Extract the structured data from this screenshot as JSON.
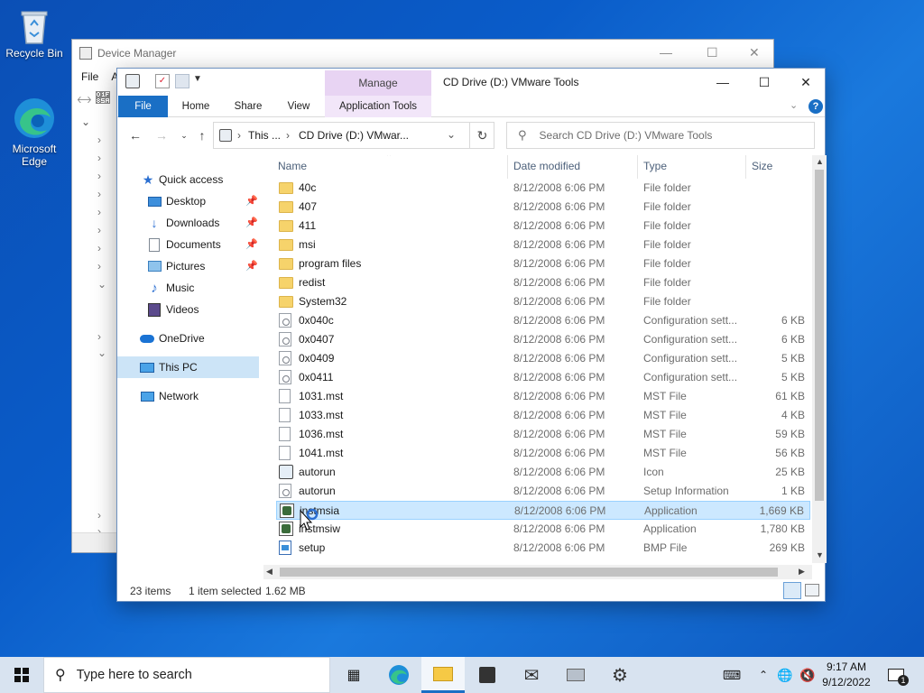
{
  "desktop": {
    "icons": [
      {
        "label": "Recycle Bin",
        "icon": "recycle-bin-icon"
      },
      {
        "label": "Microsoft Edge",
        "icon": "edge-icon"
      }
    ]
  },
  "device_manager": {
    "title": "Device Manager",
    "menu": [
      "File",
      "A"
    ]
  },
  "explorer": {
    "title": "CD Drive (D:) VMware Tools",
    "context_tab": "Manage",
    "ribbon_tabs": [
      "File",
      "Home",
      "Share",
      "View",
      "Application Tools"
    ],
    "address": {
      "crumbs": [
        "This ...",
        "CD Drive (D:) VMwar..."
      ]
    },
    "search_placeholder": "Search CD Drive (D:) VMware Tools",
    "nav": {
      "quick_access": "Quick access",
      "items": [
        {
          "label": "Desktop",
          "icon": "desktop-folder-icon",
          "pinned": true
        },
        {
          "label": "Downloads",
          "icon": "downloads-icon",
          "pinned": true
        },
        {
          "label": "Documents",
          "icon": "documents-icon",
          "pinned": true
        },
        {
          "label": "Pictures",
          "icon": "pictures-icon",
          "pinned": true
        },
        {
          "label": "Music",
          "icon": "music-icon",
          "pinned": false
        },
        {
          "label": "Videos",
          "icon": "videos-icon",
          "pinned": false
        }
      ],
      "onedrive": "OneDrive",
      "this_pc": "This PC",
      "network": "Network"
    },
    "columns": [
      "Name",
      "Date modified",
      "Type",
      "Size"
    ],
    "files": [
      {
        "name": "40c",
        "date": "8/12/2008 6:06 PM",
        "type": "File folder",
        "size": "",
        "kind": "folder"
      },
      {
        "name": "407",
        "date": "8/12/2008 6:06 PM",
        "type": "File folder",
        "size": "",
        "kind": "folder"
      },
      {
        "name": "411",
        "date": "8/12/2008 6:06 PM",
        "type": "File folder",
        "size": "",
        "kind": "folder"
      },
      {
        "name": "msi",
        "date": "8/12/2008 6:06 PM",
        "type": "File folder",
        "size": "",
        "kind": "folder"
      },
      {
        "name": "program files",
        "date": "8/12/2008 6:06 PM",
        "type": "File folder",
        "size": "",
        "kind": "folder"
      },
      {
        "name": "redist",
        "date": "8/12/2008 6:06 PM",
        "type": "File folder",
        "size": "",
        "kind": "folder"
      },
      {
        "name": "System32",
        "date": "8/12/2008 6:06 PM",
        "type": "File folder",
        "size": "",
        "kind": "folder"
      },
      {
        "name": "0x040c",
        "date": "8/12/2008 6:06 PM",
        "type": "Configuration sett...",
        "size": "6 KB",
        "kind": "config"
      },
      {
        "name": "0x0407",
        "date": "8/12/2008 6:06 PM",
        "type": "Configuration sett...",
        "size": "6 KB",
        "kind": "config"
      },
      {
        "name": "0x0409",
        "date": "8/12/2008 6:06 PM",
        "type": "Configuration sett...",
        "size": "5 KB",
        "kind": "config"
      },
      {
        "name": "0x0411",
        "date": "8/12/2008 6:06 PM",
        "type": "Configuration sett...",
        "size": "5 KB",
        "kind": "config"
      },
      {
        "name": "1031.mst",
        "date": "8/12/2008 6:06 PM",
        "type": "MST File",
        "size": "61 KB",
        "kind": "mst"
      },
      {
        "name": "1033.mst",
        "date": "8/12/2008 6:06 PM",
        "type": "MST File",
        "size": "4 KB",
        "kind": "mst"
      },
      {
        "name": "1036.mst",
        "date": "8/12/2008 6:06 PM",
        "type": "MST File",
        "size": "59 KB",
        "kind": "mst"
      },
      {
        "name": "1041.mst",
        "date": "8/12/2008 6:06 PM",
        "type": "MST File",
        "size": "56 KB",
        "kind": "mst"
      },
      {
        "name": "autorun",
        "date": "8/12/2008 6:06 PM",
        "type": "Icon",
        "size": "25 KB",
        "kind": "icon"
      },
      {
        "name": "autorun",
        "date": "8/12/2008 6:06 PM",
        "type": "Setup Information",
        "size": "1 KB",
        "kind": "config"
      },
      {
        "name": "instmsia",
        "date": "8/12/2008 6:06 PM",
        "type": "Application",
        "size": "1,669 KB",
        "kind": "app",
        "selected": true
      },
      {
        "name": "instmsiw",
        "date": "8/12/2008 6:06 PM",
        "type": "Application",
        "size": "1,780 KB",
        "kind": "app"
      },
      {
        "name": "setup",
        "date": "8/12/2008 6:06 PM",
        "type": "BMP File",
        "size": "269 KB",
        "kind": "bmp"
      }
    ],
    "status": {
      "count": "23 items",
      "selected": "1 item selected",
      "size": "1.62 MB"
    }
  },
  "taskbar": {
    "search_placeholder": "Type here to search",
    "time": "9:17 AM",
    "date": "9/12/2022",
    "notification_count": "1"
  },
  "colors": {
    "accent": "#1a6fc5",
    "manage_tab": "#e8d4f3",
    "selection": "#cce8ff"
  }
}
